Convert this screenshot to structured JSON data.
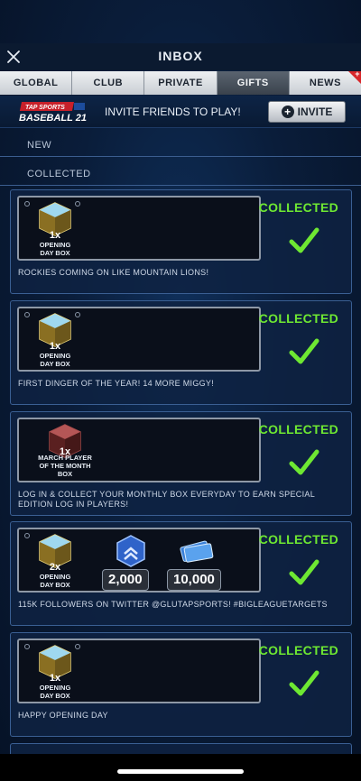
{
  "header": {
    "title": "INBOX"
  },
  "tabs": [
    {
      "label": "GLOBAL"
    },
    {
      "label": "CLUB"
    },
    {
      "label": "PRIVATE"
    },
    {
      "label": "GIFTS"
    },
    {
      "label": "NEWS"
    }
  ],
  "active_tab": "GIFTS",
  "invite_bar": {
    "logo_top": "TAP SPORTS",
    "logo_bottom": "BASEBALL 21",
    "text": "INVITE FRIENDS TO PLAY!",
    "button_label": "INVITE"
  },
  "sections": {
    "new": "NEW",
    "collected": "COLLECTED"
  },
  "cards": [
    {
      "status": "COLLECTED",
      "message": "ROCKIES COMING ON LIKE MOUNTAIN LIONS!",
      "items": [
        {
          "qty": "1x",
          "name": "OPENING DAY BOX",
          "kind": "gold-box"
        }
      ]
    },
    {
      "status": "COLLECTED",
      "message": "FIRST DINGER OF THE YEAR! 14 MORE MIGGY!",
      "items": [
        {
          "qty": "1x",
          "name": "OPENING DAY BOX",
          "kind": "gold-box"
        }
      ]
    },
    {
      "status": "COLLECTED",
      "message": "LOG IN & COLLECT YOUR MONTHLY BOX EVERYDAY TO EARN SPECIAL EDITION LOG IN PLAYERS!",
      "items": [
        {
          "qty": "1x",
          "name": "MARCH PLAYER OF THE MONTH BOX",
          "kind": "red-box"
        }
      ]
    },
    {
      "status": "COLLECTED",
      "message": "115K FOLLOWERS ON TWITTER @GLUTAPSPORTS! #BIGLEAGUETARGETS",
      "items": [
        {
          "qty": "2x",
          "name": "OPENING DAY BOX",
          "kind": "gold-box"
        },
        {
          "value": "2,000",
          "kind": "xp-badge"
        },
        {
          "value": "10,000",
          "kind": "cash"
        }
      ]
    },
    {
      "status": "COLLECTED",
      "message": "HAPPY OPENING DAY",
      "items": [
        {
          "qty": "1x",
          "name": "OPENING DAY BOX",
          "kind": "gold-box"
        }
      ]
    }
  ],
  "colors": {
    "collected": "#6ee832",
    "accent_border": "#3a5f93",
    "background": "#0a1d3a"
  }
}
